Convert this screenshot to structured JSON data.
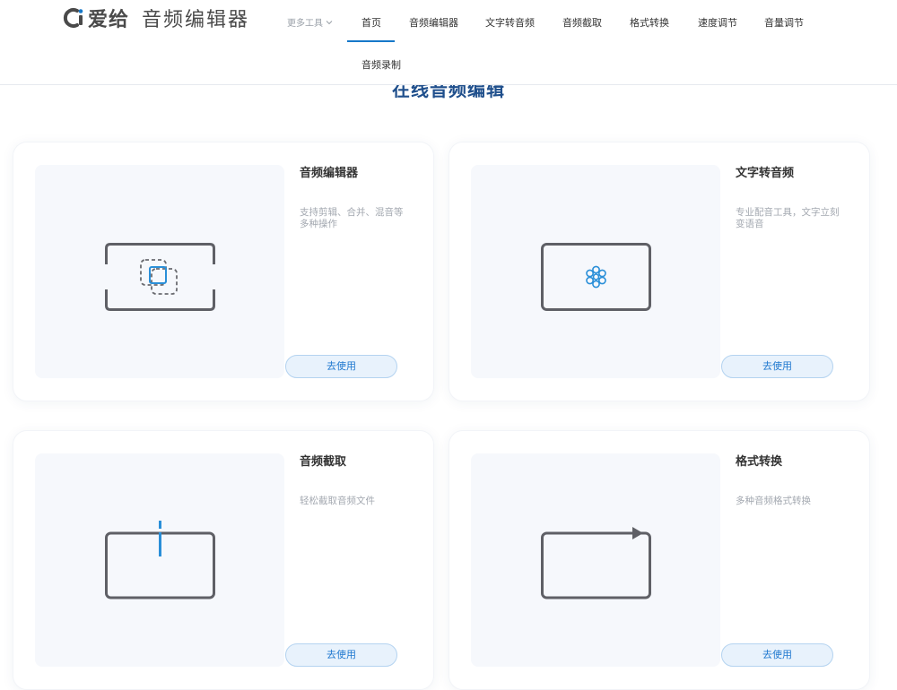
{
  "header": {
    "logo_brand": "爱给",
    "logo_product": "音频编辑器",
    "more_tools": "更多工具",
    "nav": [
      {
        "label": "首页"
      },
      {
        "label": "音频编辑器"
      },
      {
        "label": "文字转音频"
      },
      {
        "label": "音频截取"
      },
      {
        "label": "格式转换"
      },
      {
        "label": "速度调节"
      },
      {
        "label": "音量调节"
      },
      {
        "label": "音频录制"
      }
    ]
  },
  "main": {
    "title": "在线音频编辑",
    "cards": [
      {
        "title": "音频编辑器",
        "desc": "支持剪辑、合并、混音等多种操作",
        "button": "去使用",
        "icon": "edit-frame-icon"
      },
      {
        "title": "文字转音频",
        "desc": "专业配音工具，文字立刻变语音",
        "button": "去使用",
        "icon": "voice-flower-icon"
      },
      {
        "title": "音频截取",
        "desc": "轻松截取音频文件",
        "button": "去使用",
        "icon": "cut-marker-icon"
      },
      {
        "title": "格式转换",
        "desc": "多种音频格式转换",
        "button": "去使用",
        "icon": "arrow-right-icon"
      }
    ]
  },
  "colors": {
    "accent": "#1678c9",
    "title": "#1f4f8c",
    "icon_line": "#5f6066",
    "icon_accent": "#2a8fd8"
  }
}
